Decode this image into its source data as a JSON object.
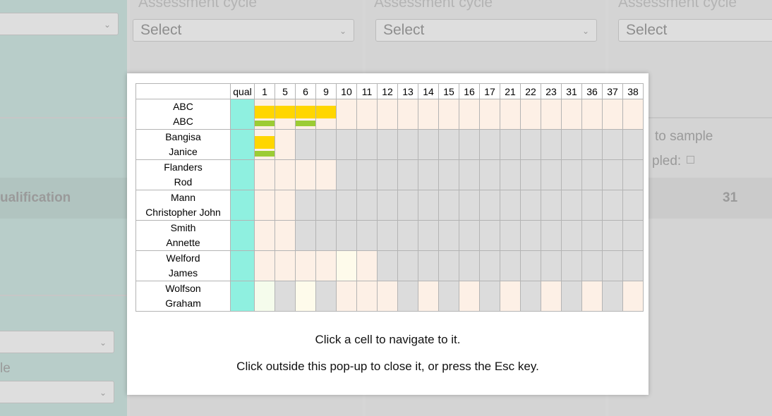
{
  "background": {
    "cycle_label": "Assessment cycle",
    "select_placeholder": "Select",
    "qualification_text": "ualification",
    "value_31": "31",
    "to_sample_text": "to sample",
    "sampled_text": "pled:",
    "cycle_partial": "le"
  },
  "popup": {
    "header_qual": "qual",
    "columns": [
      "1",
      "5",
      "6",
      "9",
      "10",
      "11",
      "12",
      "13",
      "14",
      "15",
      "16",
      "17",
      "21",
      "22",
      "23",
      "31",
      "36",
      "37",
      "38"
    ],
    "rows": [
      {
        "surname": "ABC",
        "forename": "ABC",
        "cells": [
          "pk-yg",
          "pk-y",
          "pk-yg",
          "pk-y",
          "pk",
          "pk",
          "pk",
          "pk",
          "pk",
          "pk",
          "pk",
          "pk",
          "pk",
          "pk",
          "pk",
          "pk",
          "pk",
          "pk",
          "pk"
        ]
      },
      {
        "surname": "Bangisa",
        "forename": "Janice",
        "cells": [
          "pk-yg",
          "pk",
          "gr",
          "gr",
          "gr",
          "gr",
          "gr",
          "gr",
          "gr",
          "gr",
          "gr",
          "gr",
          "gr",
          "gr",
          "gr",
          "gr",
          "gr",
          "gr",
          "gr"
        ]
      },
      {
        "surname": "Flanders",
        "forename": "Rod",
        "cells": [
          "pk",
          "pk",
          "pk",
          "pk",
          "gr",
          "gr",
          "gr",
          "gr",
          "gr",
          "gr",
          "gr",
          "gr",
          "gr",
          "gr",
          "gr",
          "gr",
          "gr",
          "gr",
          "gr"
        ]
      },
      {
        "surname": "Mann",
        "forename": "Christopher John",
        "cells": [
          "pk",
          "pk",
          "gr",
          "gr",
          "gr",
          "gr",
          "gr",
          "gr",
          "gr",
          "gr",
          "gr",
          "gr",
          "gr",
          "gr",
          "gr",
          "gr",
          "gr",
          "gr",
          "gr"
        ]
      },
      {
        "surname": "Smith",
        "forename": "Annette",
        "cells": [
          "pk",
          "pk",
          "gr",
          "gr",
          "gr",
          "gr",
          "gr",
          "gr",
          "gr",
          "gr",
          "gr",
          "gr",
          "gr",
          "gr",
          "gr",
          "gr",
          "gr",
          "gr",
          "gr"
        ]
      },
      {
        "surname": "Welford",
        "forename": "James",
        "cells": [
          "pk",
          "pk",
          "pk",
          "pk",
          "ly",
          "pk",
          "gr",
          "gr",
          "gr",
          "gr",
          "gr",
          "gr",
          "gr",
          "gr",
          "gr",
          "gr",
          "gr",
          "gr",
          "gr"
        ]
      },
      {
        "surname": "Wolfson",
        "forename": "Graham",
        "cells": [
          "lg",
          "gr",
          "ly",
          "gr",
          "pk",
          "pk",
          "pk",
          "gr",
          "pk",
          "gr",
          "pk",
          "gr",
          "pk",
          "gr",
          "pk",
          "gr",
          "pk",
          "gr",
          "pk"
        ]
      }
    ],
    "instruction_1": "Click a cell to navigate to it.",
    "instruction_2": "Click outside this pop-up to close it, or press the Esc key."
  },
  "colors": {
    "qual": "#8ff0e0",
    "pink": "#fdf0e6",
    "grey": "#dcdcdc",
    "yellow": "#ffd600",
    "green": "#9ccc34"
  }
}
